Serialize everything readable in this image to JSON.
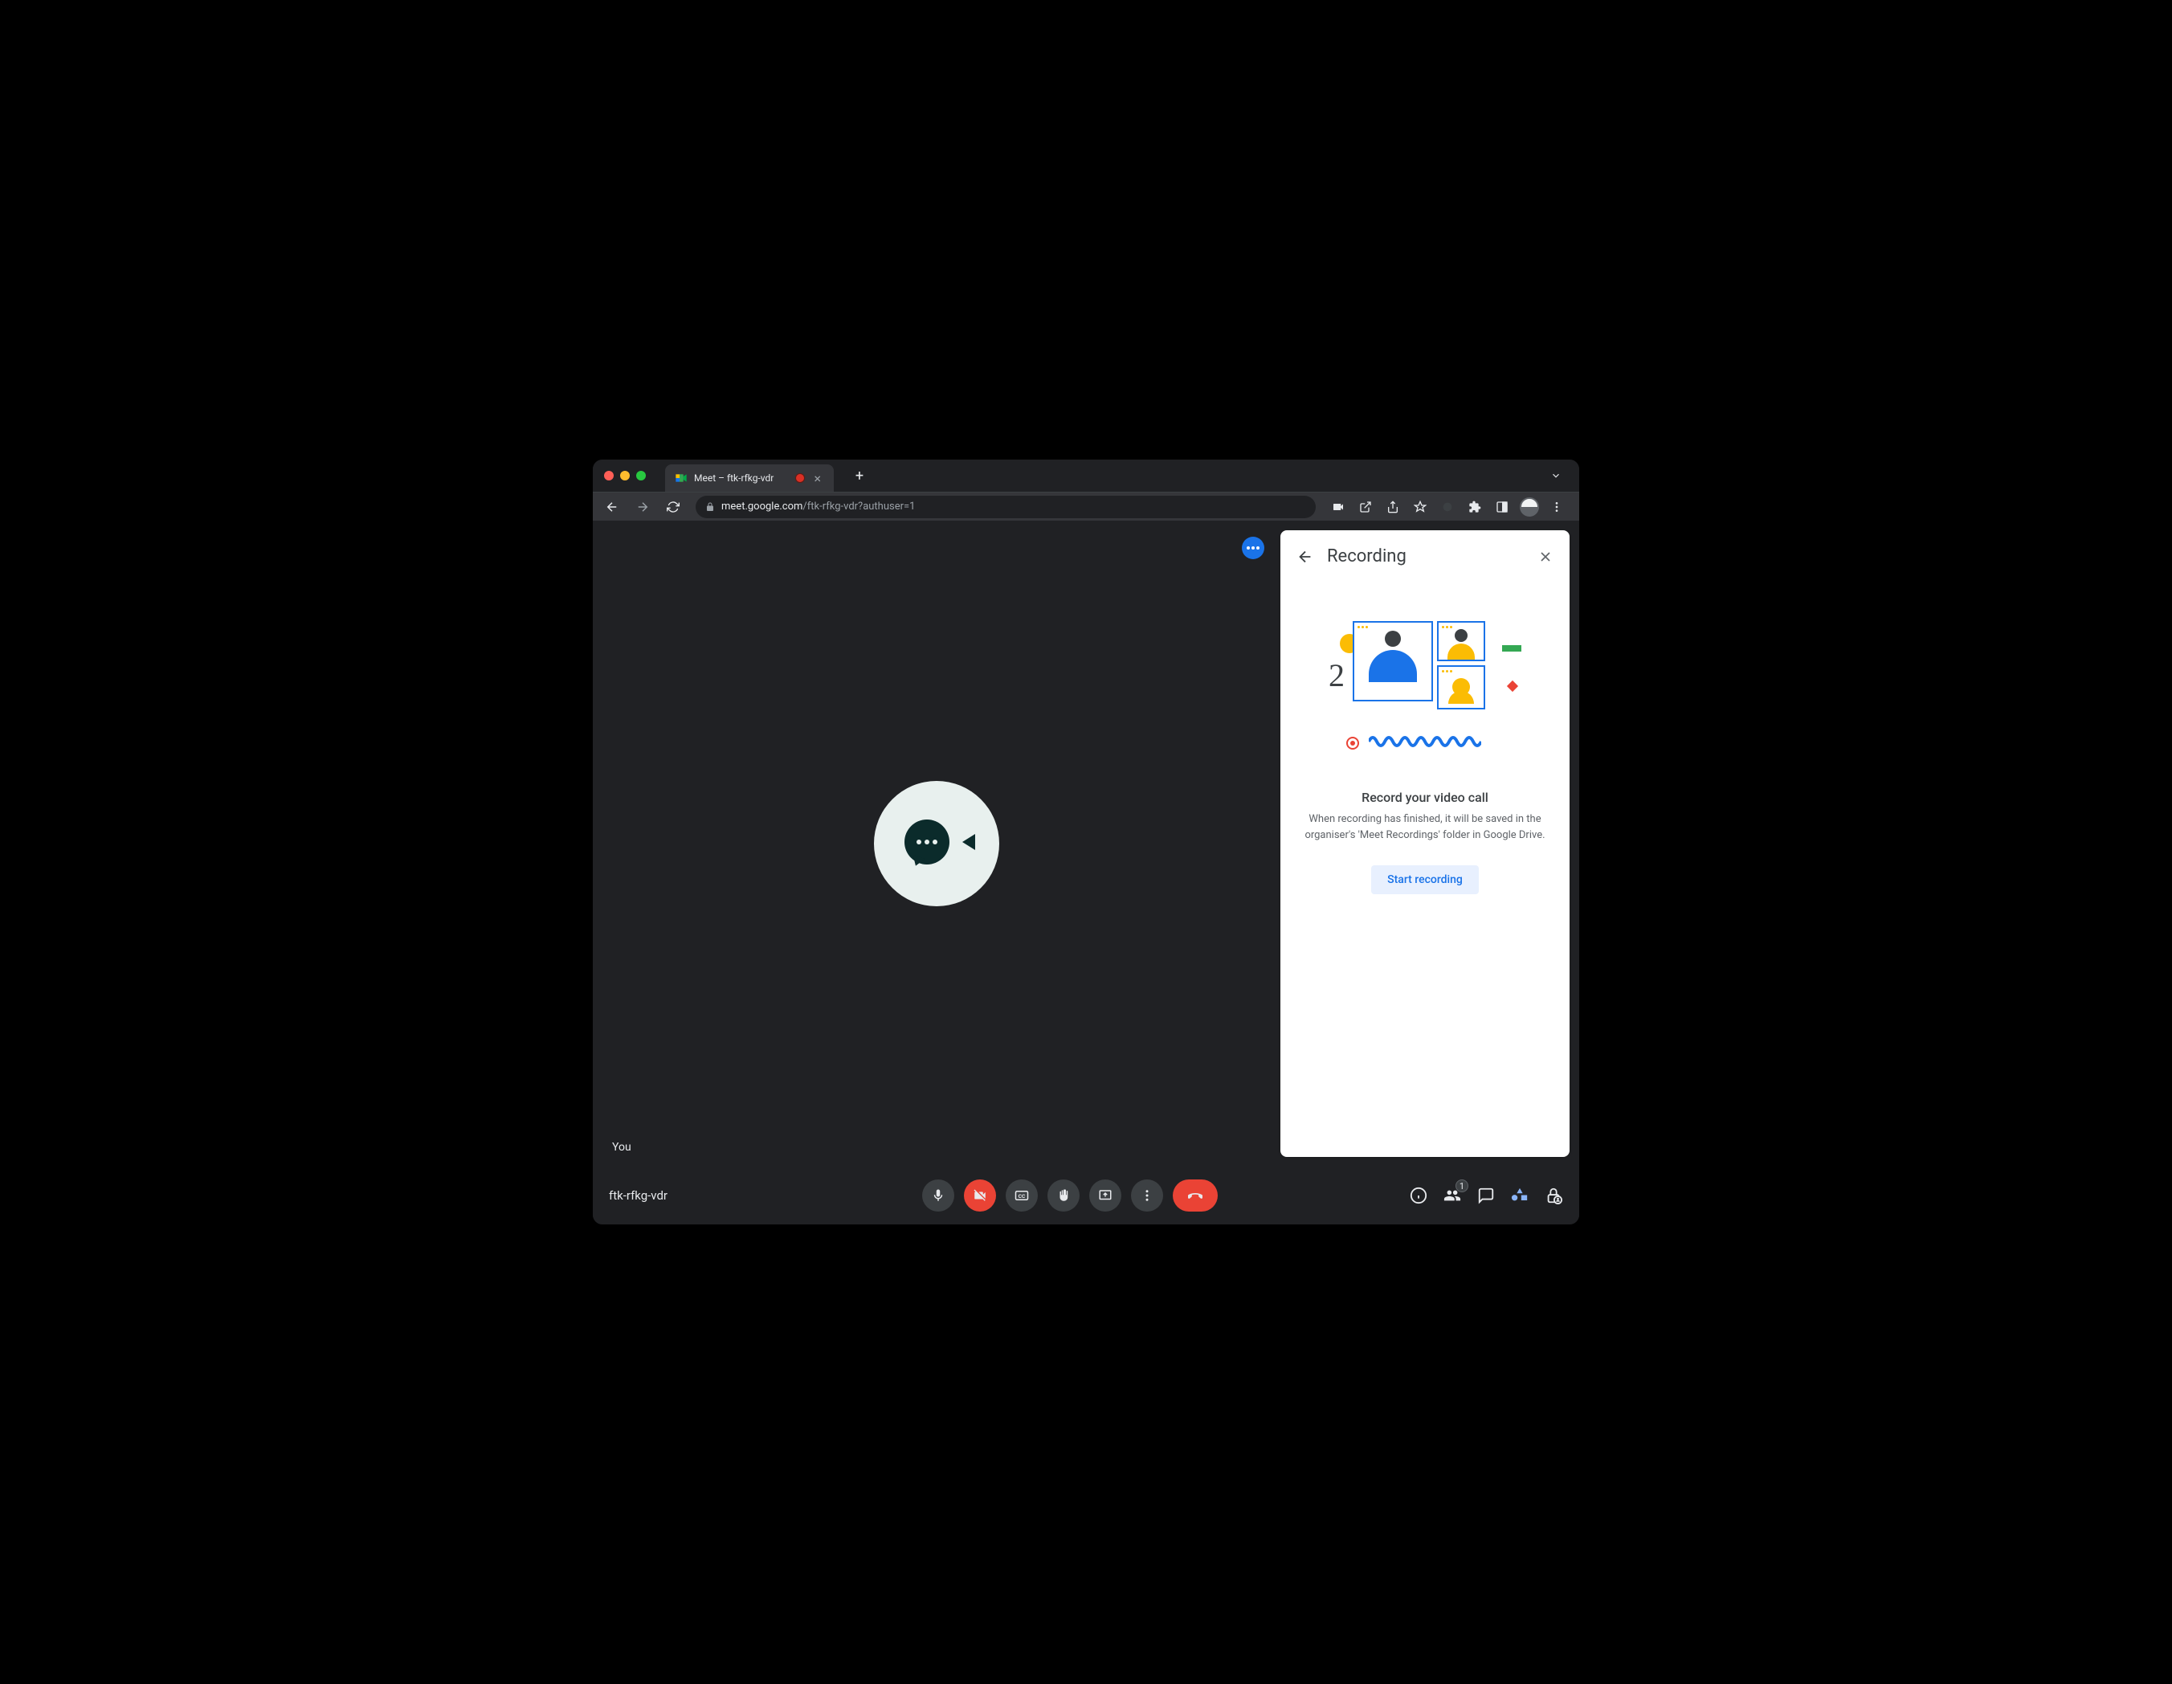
{
  "browser": {
    "tab_title": "Meet – ftk-rfkg-vdr",
    "url_host": "meet.google.com",
    "url_path": "/ftk-rfkg-vdr?authuser=1"
  },
  "meet": {
    "self_label": "You",
    "meeting_id": "ftk-rfkg-vdr",
    "participant_count": "1"
  },
  "panel": {
    "title": "Recording",
    "heading": "Record your video call",
    "description": "When recording has finished, it will be saved in the organiser's 'Meet Recordings' folder in Google Drive.",
    "button": "Start recording"
  }
}
